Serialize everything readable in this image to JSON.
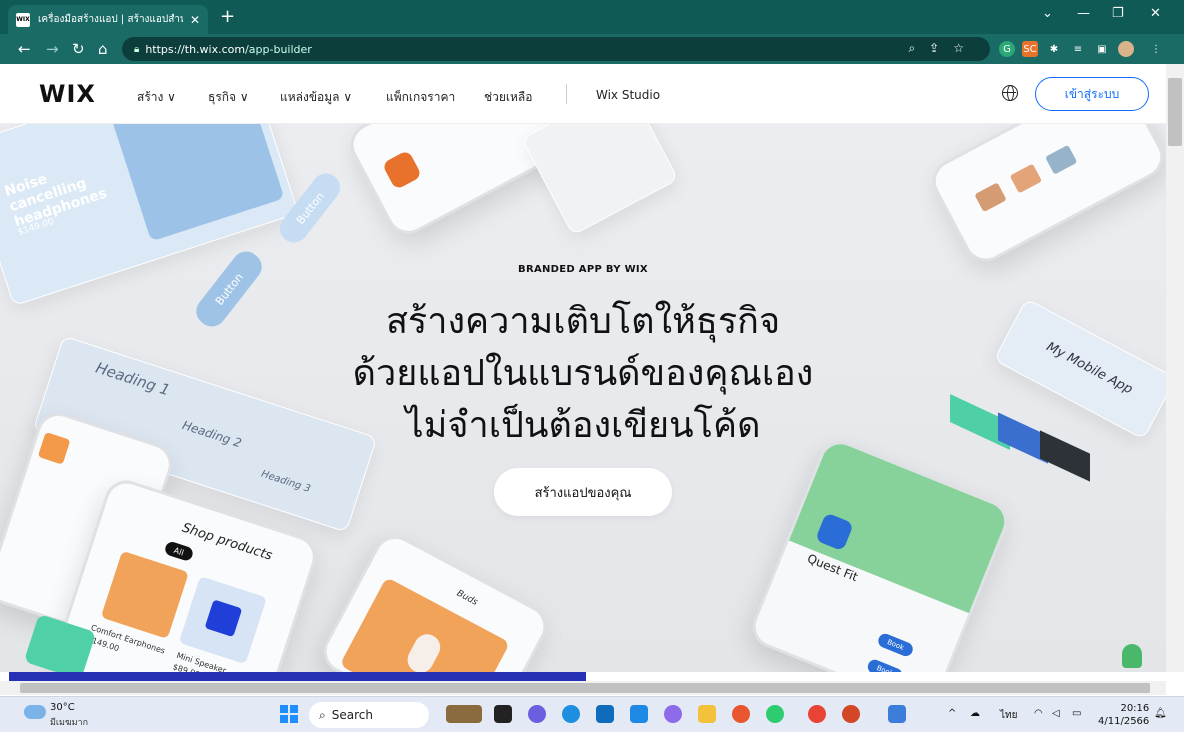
{
  "browser": {
    "tab_title": "เครื่องมือสร้างแอป | สร้างแอปสำหรับ",
    "tab_favicon": "WIX",
    "url_host": "https://th.wix.com",
    "url_path": "/app-builder"
  },
  "site": {
    "logo": "WIX",
    "nav": [
      {
        "label": "สร้าง ∨"
      },
      {
        "label": "ธุรกิจ ∨"
      },
      {
        "label": "แหล่งข้อมูล ∨"
      },
      {
        "label": "แพ็กเกจราคา"
      },
      {
        "label": "ช่วยเหลือ"
      },
      {
        "label": "Wix Studio"
      }
    ],
    "login": "เข้าสู่ระบบ"
  },
  "hero": {
    "eyebrow": "BRANDED APP BY WIX",
    "line1": "สร้างความเติบโตให้ธุรกิจ",
    "line2": "ด้วยแอปในแบรนด์ของคุณเอง",
    "line3": "ไม่จำเป็นต้องเขียนโค้ด",
    "cta": "สร้างแอปของคุณ"
  },
  "decor": {
    "noise_title": "Noise cancelling headphones",
    "price": "$149.00",
    "button1": "Button",
    "button2": "Button",
    "heading1": "Heading 1",
    "heading2": "Heading 2",
    "heading3": "Heading 3",
    "shop_title": "Shop products",
    "shop_tab": "All",
    "product1": "Comfort Earphones",
    "product1_price": "$149.00",
    "product2": "Mini Speaker",
    "product2_price": "$89.00",
    "buds": "Buds",
    "my_mobile_app": "My Mobile App",
    "quest_fit": "Quest Fit",
    "book1": "Book",
    "book2": "Book"
  },
  "colors": {
    "wix_blue": "#116dff",
    "browser_chrome": "#1a6b66",
    "progress": "#2531b4"
  },
  "taskbar": {
    "temp": "30°C",
    "weather": "มีเมฆมาก",
    "search": "Search",
    "lang": "ไทย",
    "time": "20:16",
    "date": "4/11/2566"
  }
}
